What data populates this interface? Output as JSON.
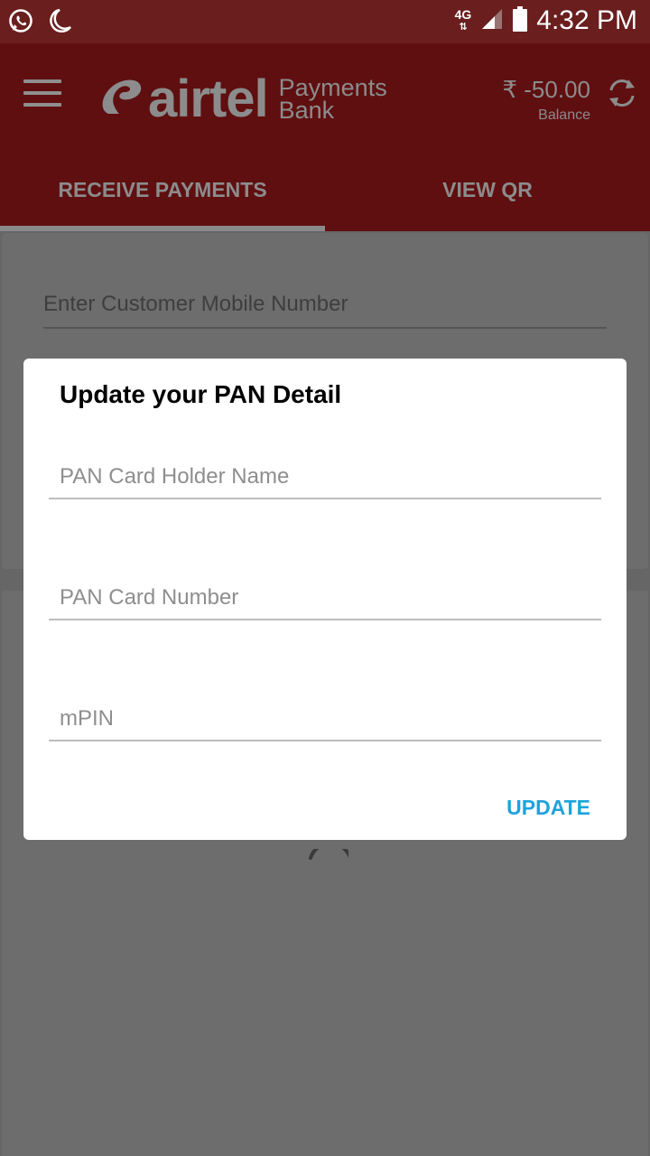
{
  "status_bar": {
    "time": "4:32 PM",
    "network": "4G"
  },
  "header": {
    "brand": "airtel",
    "brand_sub_1": "Payments",
    "brand_sub_2": "Bank",
    "balance_amount": "₹ -50.00",
    "balance_label": "Balance"
  },
  "tabs": [
    {
      "label": "RECEIVE PAYMENTS",
      "selected": true
    },
    {
      "label": "VIEW QR",
      "selected": false
    }
  ],
  "background": {
    "mobile_placeholder": "Enter Customer Mobile Number"
  },
  "dialog": {
    "title": "Update your PAN Detail",
    "holder_name_placeholder": "PAN Card Holder Name",
    "pan_number_placeholder": "PAN Card Number",
    "mpin_placeholder": "mPIN",
    "update_label": "UPDATE"
  },
  "colors": {
    "accent": "#1ea3dc",
    "brand_dim": "#5f0f10",
    "statusbar": "#6a1e1e"
  },
  "icons": [
    "whatsapp-icon",
    "moon-icon",
    "signal-icon",
    "battery-icon",
    "menu-icon",
    "refresh-icon",
    "airtel-logo-icon"
  ]
}
